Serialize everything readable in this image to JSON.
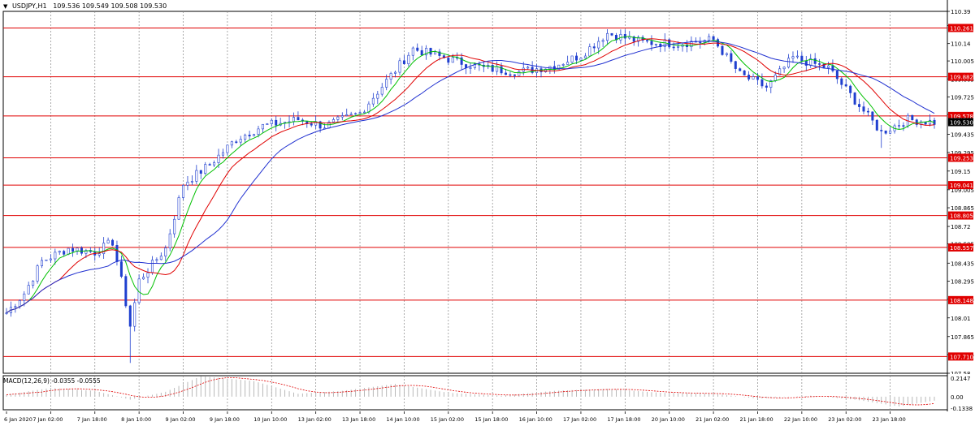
{
  "header": {
    "symbol": "USDJPY,H1",
    "ohlc": "109.536 109.549 109.508 109.530"
  },
  "macd": {
    "label": "MACD(12,26,9) -0.0355 -0.0555",
    "scale_labels": [
      "0.2147",
      "0.00",
      "-0.1338"
    ]
  },
  "colors": {
    "up_candle": "#1f3fcf",
    "ma_fast": "#00c000",
    "ma_mid": "#e00000",
    "ma_slow": "#2030d0",
    "level_line": "#e00000",
    "level_badge_bg": "#e00000",
    "current_badge_bg": "#000000",
    "grid": "#888888",
    "macd_hist": "#b0b0b0",
    "macd_signal": "#e00000"
  },
  "chart_data": {
    "type": "candlestick",
    "symbol": "USDJPY",
    "timeframe": "H1",
    "ylim": [
      107.58,
      110.39
    ],
    "price_scale_labels": [
      "110.39",
      "110.28",
      "110.14",
      "110.005",
      "109.865",
      "109.725",
      "109.59",
      "109.435",
      "109.295",
      "109.15",
      "109.005",
      "108.865",
      "108.72",
      "108.585",
      "108.435",
      "108.295",
      "108.155",
      "108.01",
      "107.865",
      "107.725",
      "107.58"
    ],
    "horizontal_levels": [
      {
        "label": "110.261",
        "value": 110.261
      },
      {
        "label": "109.882",
        "value": 109.882
      },
      {
        "label": "109.578",
        "value": 109.578
      },
      {
        "label": "109.253",
        "value": 109.253
      },
      {
        "label": "109.041",
        "value": 109.041
      },
      {
        "label": "108.805",
        "value": 108.805
      },
      {
        "label": "108.557",
        "value": 108.557
      },
      {
        "label": "108.148",
        "value": 108.148
      },
      {
        "label": "107.710",
        "value": 107.71
      }
    ],
    "current_price": {
      "label": "109.530",
      "value": 109.53
    },
    "time_labels": [
      "6 Jan 2020",
      "7 Jan 02:00",
      "7 Jan 18:00",
      "8 Jan 10:00",
      "9 Jan 02:00",
      "9 Jan 18:00",
      "10 Jan 10:00",
      "13 Jan 02:00",
      "13 Jan 18:00",
      "14 Jan 10:00",
      "15 Jan 02:00",
      "15 Jan 18:00",
      "16 Jan 10:00",
      "17 Jan 02:00",
      "17 Jan 18:00",
      "20 Jan 10:00",
      "21 Jan 02:00",
      "21 Jan 18:00",
      "22 Jan 10:00",
      "23 Jan 02:00",
      "23 Jan 18:00"
    ],
    "close_path": [
      {
        "i": 0,
        "v": 108.05
      },
      {
        "i": 4,
        "v": 108.2
      },
      {
        "i": 8,
        "v": 108.45
      },
      {
        "i": 14,
        "v": 108.55
      },
      {
        "i": 20,
        "v": 108.52
      },
      {
        "i": 24,
        "v": 108.6
      },
      {
        "i": 26,
        "v": 108.3
      },
      {
        "i": 28,
        "v": 107.95
      },
      {
        "i": 30,
        "v": 108.3
      },
      {
        "i": 36,
        "v": 108.55
      },
      {
        "i": 40,
        "v": 109.05
      },
      {
        "i": 46,
        "v": 109.2
      },
      {
        "i": 52,
        "v": 109.4
      },
      {
        "i": 58,
        "v": 109.5
      },
      {
        "i": 66,
        "v": 109.55
      },
      {
        "i": 72,
        "v": 109.5
      },
      {
        "i": 80,
        "v": 109.6
      },
      {
        "i": 86,
        "v": 109.85
      },
      {
        "i": 92,
        "v": 110.1
      },
      {
        "i": 100,
        "v": 110.02
      },
      {
        "i": 108,
        "v": 109.95
      },
      {
        "i": 116,
        "v": 109.92
      },
      {
        "i": 124,
        "v": 109.97
      },
      {
        "i": 130,
        "v": 110.05
      },
      {
        "i": 136,
        "v": 110.22
      },
      {
        "i": 144,
        "v": 110.15
      },
      {
        "i": 152,
        "v": 110.14
      },
      {
        "i": 160,
        "v": 110.17
      },
      {
        "i": 166,
        "v": 109.9
      },
      {
        "i": 172,
        "v": 109.8
      },
      {
        "i": 178,
        "v": 110.03
      },
      {
        "i": 186,
        "v": 109.95
      },
      {
        "i": 192,
        "v": 109.7
      },
      {
        "i": 198,
        "v": 109.45
      },
      {
        "i": 204,
        "v": 109.55
      },
      {
        "i": 210,
        "v": 109.53
      }
    ],
    "candle_count": 211,
    "macd_histogram_path": [
      {
        "i": 0,
        "v": 0.02
      },
      {
        "i": 10,
        "v": 0.09
      },
      {
        "i": 20,
        "v": 0.06
      },
      {
        "i": 28,
        "v": -0.03
      },
      {
        "i": 36,
        "v": 0.05
      },
      {
        "i": 44,
        "v": 0.21
      },
      {
        "i": 56,
        "v": 0.16
      },
      {
        "i": 66,
        "v": 0.03
      },
      {
        "i": 76,
        "v": 0.06
      },
      {
        "i": 88,
        "v": 0.13
      },
      {
        "i": 100,
        "v": 0.04
      },
      {
        "i": 112,
        "v": 0.01
      },
      {
        "i": 124,
        "v": 0.06
      },
      {
        "i": 136,
        "v": 0.08
      },
      {
        "i": 148,
        "v": 0.04
      },
      {
        "i": 160,
        "v": 0.03
      },
      {
        "i": 170,
        "v": -0.02
      },
      {
        "i": 182,
        "v": 0.01
      },
      {
        "i": 192,
        "v": -0.03
      },
      {
        "i": 202,
        "v": -0.1
      },
      {
        "i": 210,
        "v": -0.04
      }
    ],
    "macd_ylim": [
      -0.1338,
      0.2147
    ],
    "moving_averages": [
      {
        "color_key": "ma_fast",
        "period_hint": "fast"
      },
      {
        "color_key": "ma_mid",
        "period_hint": "mid"
      },
      {
        "color_key": "ma_slow",
        "period_hint": "slow"
      }
    ]
  }
}
